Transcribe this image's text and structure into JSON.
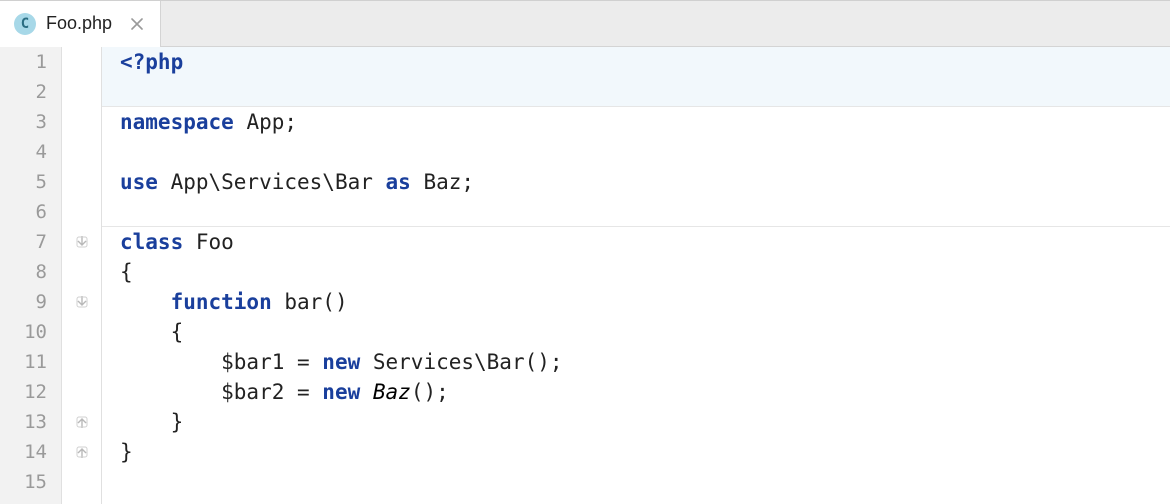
{
  "tab": {
    "icon_letter": "C",
    "filename": "Foo.php"
  },
  "editor": {
    "line_count": 15,
    "fold_markers": [
      {
        "line": 7,
        "kind": "open-down"
      },
      {
        "line": 9,
        "kind": "open-down"
      },
      {
        "line": 13,
        "kind": "close-up"
      },
      {
        "line": 14,
        "kind": "close-up"
      }
    ],
    "lines": [
      {
        "n": 1,
        "hl": true,
        "sep": false,
        "tokens": [
          {
            "t": "<?php",
            "c": "kw"
          }
        ]
      },
      {
        "n": 2,
        "hl": true,
        "sep": true,
        "tokens": []
      },
      {
        "n": 3,
        "hl": false,
        "sep": false,
        "tokens": [
          {
            "t": "namespace ",
            "c": "kw"
          },
          {
            "t": "App",
            "c": "txt"
          },
          {
            "t": ";",
            "c": "punc"
          }
        ]
      },
      {
        "n": 4,
        "hl": false,
        "sep": false,
        "tokens": []
      },
      {
        "n": 5,
        "hl": false,
        "sep": false,
        "tokens": [
          {
            "t": "use ",
            "c": "kw"
          },
          {
            "t": "App\\Services\\Bar ",
            "c": "txt"
          },
          {
            "t": "as ",
            "c": "kw"
          },
          {
            "t": "Baz",
            "c": "txt"
          },
          {
            "t": ";",
            "c": "punc"
          }
        ]
      },
      {
        "n": 6,
        "hl": false,
        "sep": true,
        "tokens": []
      },
      {
        "n": 7,
        "hl": false,
        "sep": false,
        "tokens": [
          {
            "t": "class ",
            "c": "kw"
          },
          {
            "t": "Foo",
            "c": "txt"
          }
        ]
      },
      {
        "n": 8,
        "hl": false,
        "sep": false,
        "tokens": [
          {
            "t": "{",
            "c": "punc"
          }
        ]
      },
      {
        "n": 9,
        "hl": false,
        "sep": false,
        "tokens": [
          {
            "t": "    ",
            "c": "txt"
          },
          {
            "t": "function ",
            "c": "kw"
          },
          {
            "t": "bar()",
            "c": "txt"
          }
        ]
      },
      {
        "n": 10,
        "hl": false,
        "sep": false,
        "tokens": [
          {
            "t": "    {",
            "c": "punc"
          }
        ]
      },
      {
        "n": 11,
        "hl": false,
        "sep": false,
        "tokens": [
          {
            "t": "        $bar1 = ",
            "c": "txt"
          },
          {
            "t": "new ",
            "c": "kw"
          },
          {
            "t": "Services\\Bar()",
            "c": "txt"
          },
          {
            "t": ";",
            "c": "punc"
          }
        ]
      },
      {
        "n": 12,
        "hl": false,
        "sep": false,
        "tokens": [
          {
            "t": "        $bar2 = ",
            "c": "txt"
          },
          {
            "t": "new ",
            "c": "kw"
          },
          {
            "t": "Baz",
            "c": "ital"
          },
          {
            "t": "()",
            "c": "txt"
          },
          {
            "t": ";",
            "c": "punc"
          }
        ]
      },
      {
        "n": 13,
        "hl": false,
        "sep": false,
        "tokens": [
          {
            "t": "    }",
            "c": "punc"
          }
        ]
      },
      {
        "n": 14,
        "hl": false,
        "sep": false,
        "tokens": [
          {
            "t": "}",
            "c": "punc"
          }
        ]
      },
      {
        "n": 15,
        "hl": false,
        "sep": false,
        "tokens": []
      }
    ]
  }
}
